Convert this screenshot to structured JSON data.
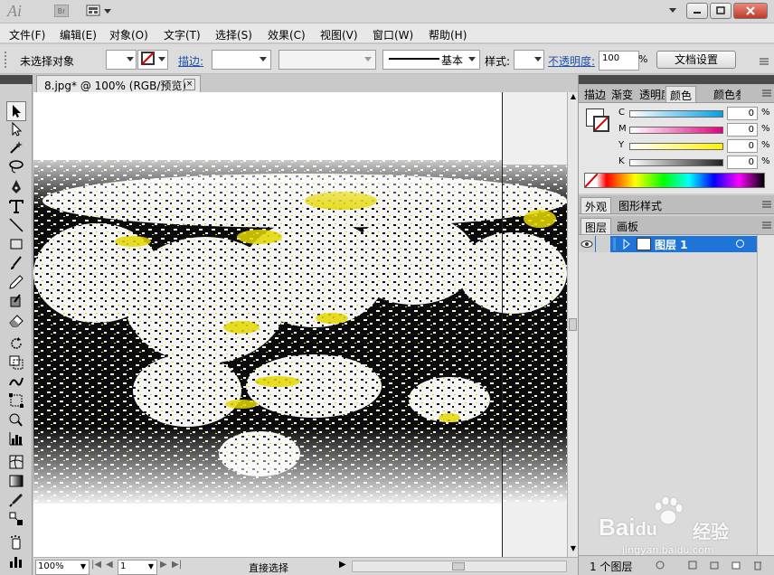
{
  "titlebar": {
    "app_name": "Ai",
    "bridge_label": "Br"
  },
  "menu": [
    "文件(F)",
    "编辑(E)",
    "对象(O)",
    "文字(T)",
    "选择(S)",
    "效果(C)",
    "视图(V)",
    "窗口(W)",
    "帮助(H)"
  ],
  "control": {
    "selection_status": "未选择对象",
    "stroke_label": "描边:",
    "profile_label": "基本",
    "style_label": "样式:",
    "opacity_label": "不透明度:",
    "opacity_value": "100",
    "opacity_unit": "%",
    "doc_setup_button": "文档设置"
  },
  "document": {
    "tab_title": "8.jpg* @ 100% (RGB/预览)"
  },
  "status": {
    "zoom": "100%",
    "artboard": "1",
    "tool_name": "直接选择"
  },
  "color_panel": {
    "tabs": [
      "描边",
      "渐变",
      "透明度",
      "颜色",
      "颜色参考"
    ],
    "active_tab": "颜色",
    "channels": [
      {
        "label": "C",
        "value": "0",
        "unit": "%",
        "color": "#00a0e9"
      },
      {
        "label": "M",
        "value": "0",
        "unit": "%",
        "color": "#e4007f"
      },
      {
        "label": "Y",
        "value": "0",
        "unit": "%",
        "color": "#fff100"
      },
      {
        "label": "K",
        "value": "0",
        "unit": "%",
        "color": "#222222"
      }
    ]
  },
  "appearance_panel": {
    "tabs": [
      "外观",
      "图形样式"
    ]
  },
  "layers_panel": {
    "tabs": [
      "图层",
      "画板"
    ],
    "layer_name": "图层 1",
    "layer_count": "1 个图层"
  },
  "watermark": {
    "text": "jingyan.baidu.com",
    "brand_suffix": "经验"
  },
  "colors": {
    "selection_blue": "#1e74d9",
    "photo_yellow": "#e5d800"
  }
}
